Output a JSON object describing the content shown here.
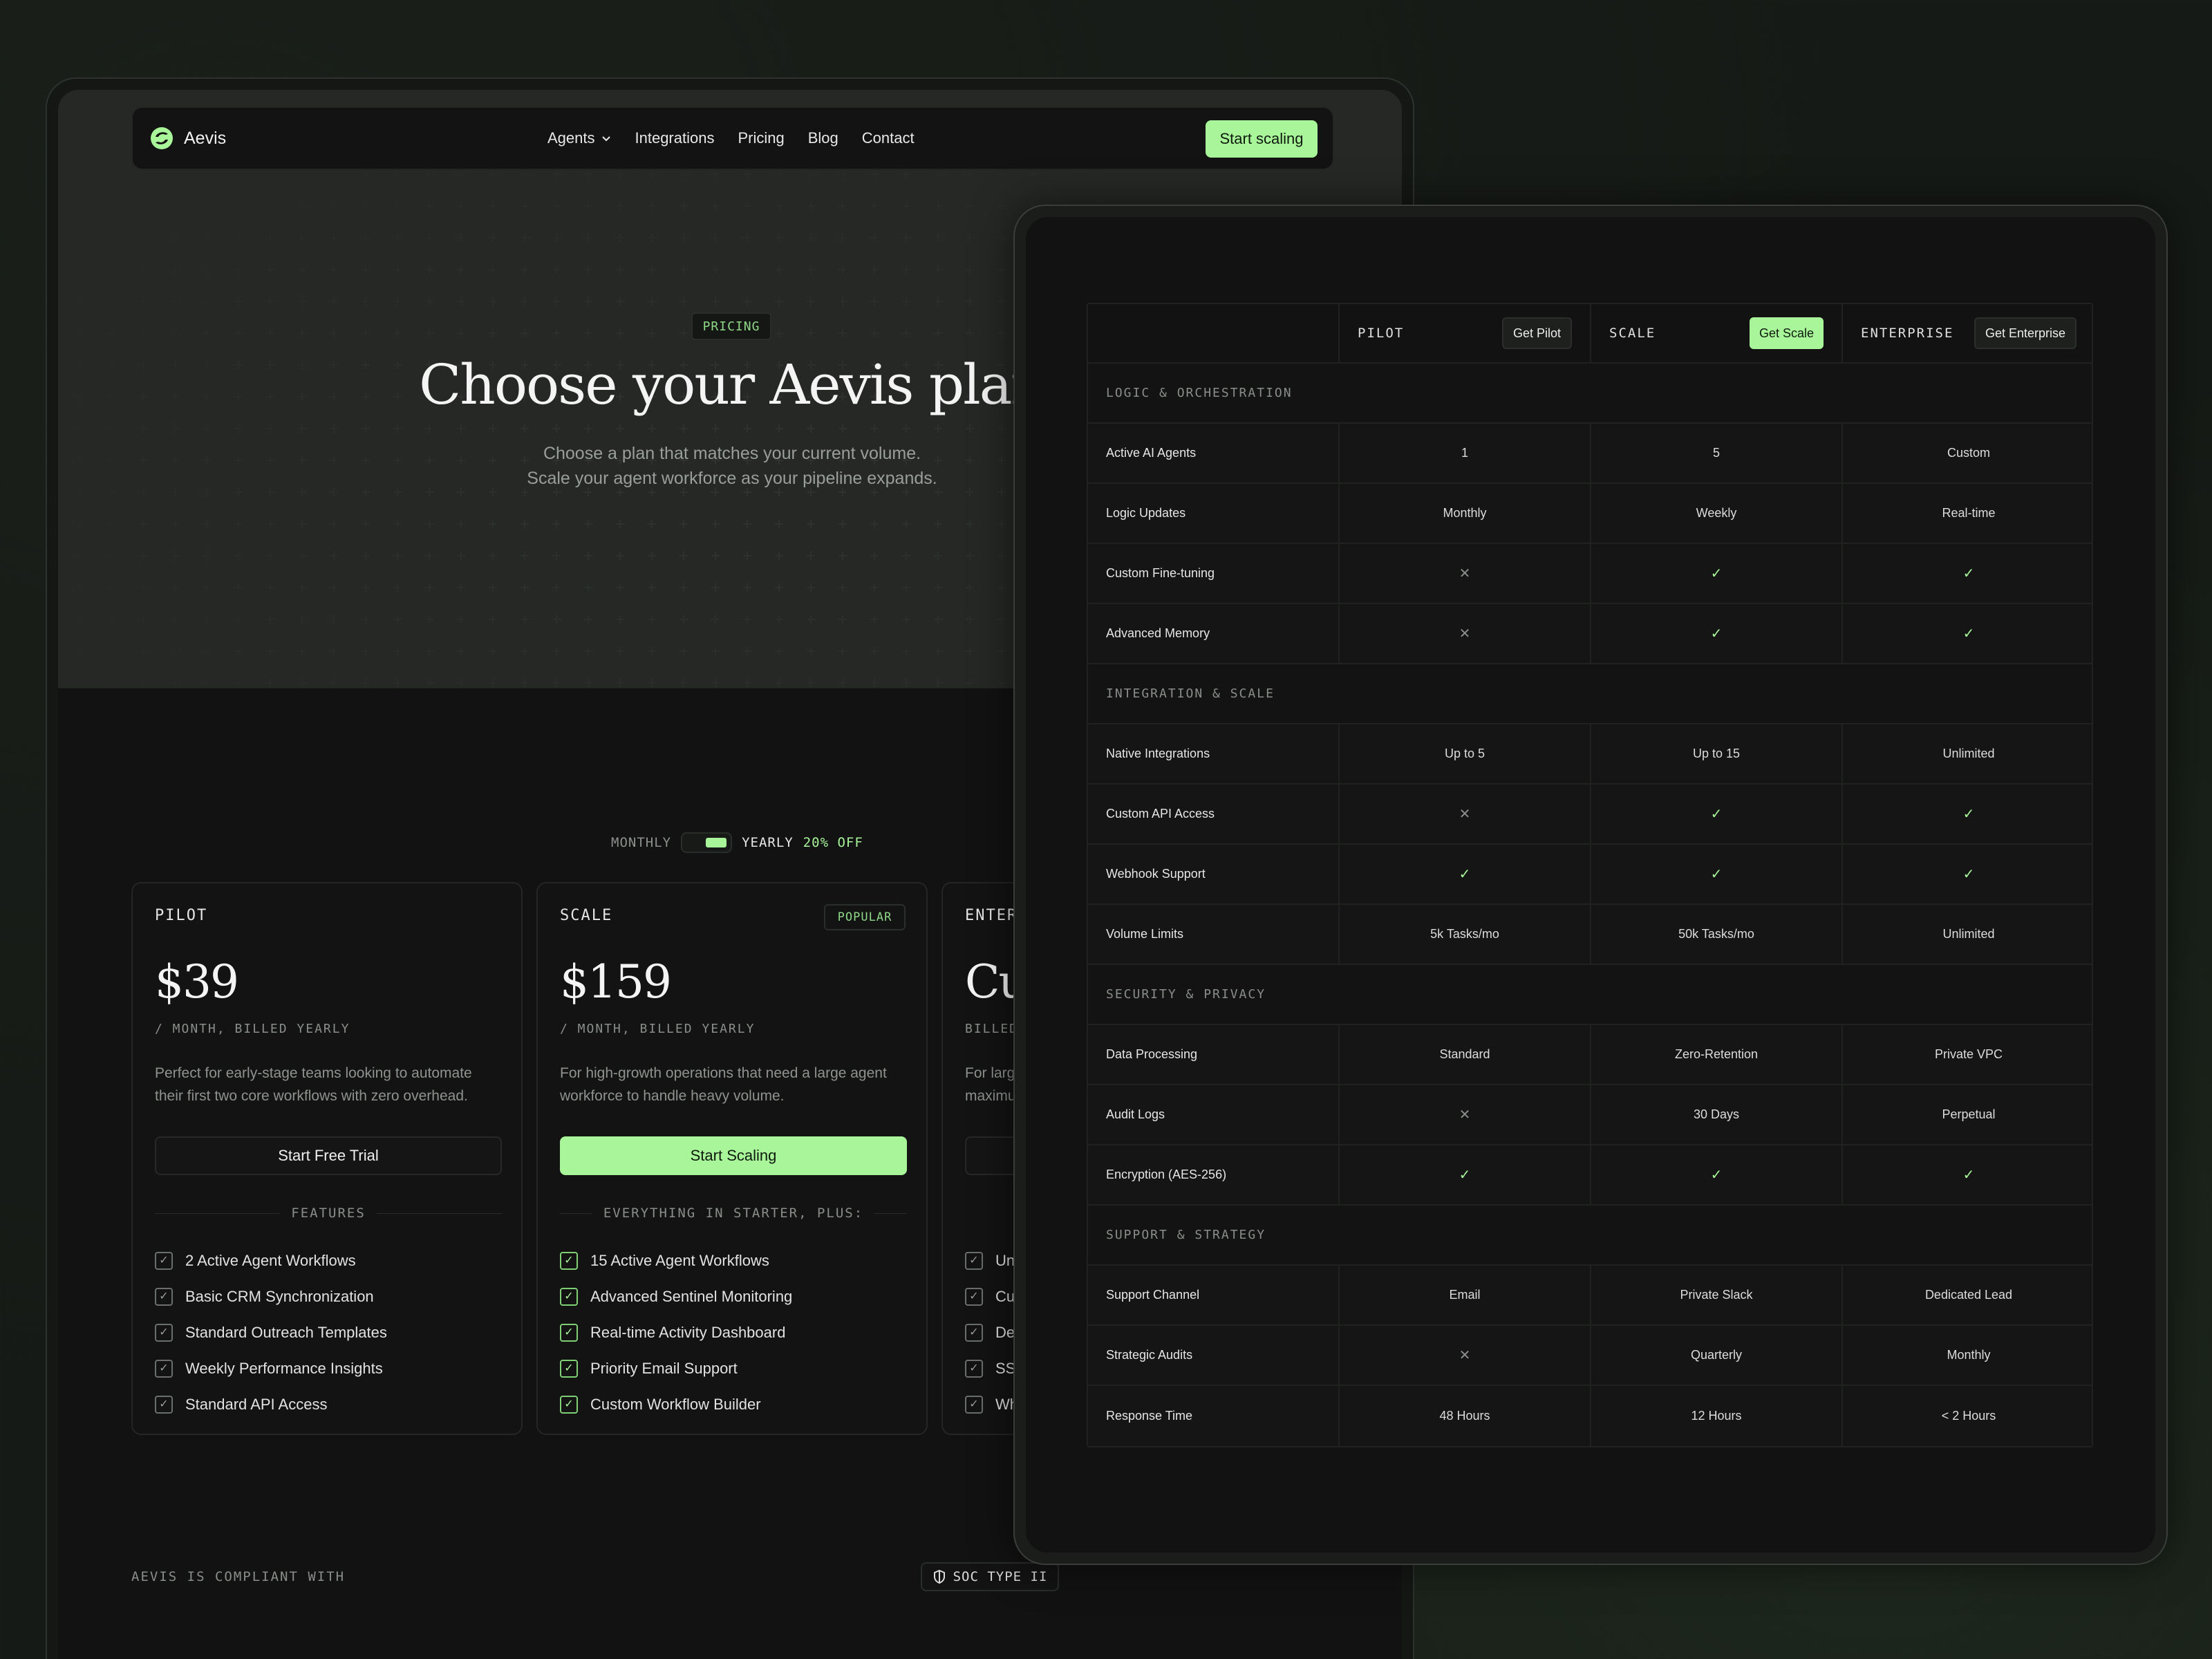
{
  "brand": {
    "name": "Aevis"
  },
  "nav": {
    "links": [
      {
        "label": "Agents",
        "has_dropdown": true
      },
      {
        "label": "Integrations"
      },
      {
        "label": "Pricing"
      },
      {
        "label": "Blog"
      },
      {
        "label": "Contact"
      }
    ],
    "cta": "Start scaling"
  },
  "hero": {
    "badge": "PRICING",
    "title": "Choose your Aevis plan",
    "subtitle_line1": "Choose a plan that matches your current volume.",
    "subtitle_line2": "Scale your agent workforce as your pipeline expands."
  },
  "billing": {
    "monthly": "MONTHLY",
    "yearly": "YEARLY",
    "discount": "20% OFF",
    "selected": "yearly"
  },
  "plans": [
    {
      "tier": "PILOT",
      "price": "$39",
      "period": "/ MONTH, BILLED YEARLY",
      "description": "Perfect for early-stage teams looking to automate their first two core workflows with zero overhead.",
      "cta": "Start Free Trial",
      "features_title": "FEATURES",
      "features": [
        "2 Active Agent Workflows",
        "Basic CRM Synchronization",
        "Standard Outreach Templates",
        "Weekly Performance Insights",
        "Standard API Access"
      ]
    },
    {
      "tier": "SCALE",
      "badge": "POPULAR",
      "price": "$159",
      "period": "/ MONTH, BILLED YEARLY",
      "description": "For high-growth operations that need a large agent workforce to handle heavy volume.",
      "cta": "Start Scaling",
      "features_title": "EVERYTHING IN STARTER, PLUS:",
      "features": [
        "15 Active Agent Workflows",
        "Advanced Sentinel Monitoring",
        "Real-time Activity Dashboard",
        "Priority Email Support",
        "Custom Workflow Builder"
      ]
    },
    {
      "tier": "ENTERI",
      "price": "Cu",
      "period": "BILLED",
      "description_line1": "For larg",
      "description_line2": "maximu",
      "features": [
        "Un",
        "Cu",
        "De",
        "SS",
        "Wh"
      ]
    }
  ],
  "compliance": {
    "label": "AEVIS IS COMPLIANT WITH",
    "badge": "SOC TYPE II"
  },
  "comparison": {
    "columns": [
      {
        "tier": "PILOT",
        "button": "Get Pilot"
      },
      {
        "tier": "SCALE",
        "button": "Get Scale"
      },
      {
        "tier": "ENTERPRISE",
        "button": "Get Enterprise"
      }
    ],
    "sections": [
      {
        "title": "LOGIC & ORCHESTRATION",
        "rows": [
          {
            "feature": "Active AI Agents",
            "values": [
              "1",
              "5",
              "Custom"
            ]
          },
          {
            "feature": "Logic Updates",
            "values": [
              "Monthly",
              "Weekly",
              "Real-time"
            ]
          },
          {
            "feature": "Custom Fine-tuning",
            "values": [
              "✕",
              "✓",
              "✓"
            ]
          },
          {
            "feature": "Advanced Memory",
            "values": [
              "✕",
              "✓",
              "✓"
            ]
          }
        ]
      },
      {
        "title": "INTEGRATION & SCALE",
        "rows": [
          {
            "feature": "Native Integrations",
            "values": [
              "Up to 5",
              "Up to 15",
              "Unlimited"
            ]
          },
          {
            "feature": "Custom API Access",
            "values": [
              "✕",
              "✓",
              "✓"
            ]
          },
          {
            "feature": "Webhook Support",
            "values": [
              "✓",
              "✓",
              "✓"
            ]
          },
          {
            "feature": "Volume Limits",
            "values": [
              "5k Tasks/mo",
              "50k Tasks/mo",
              "Unlimited"
            ]
          }
        ]
      },
      {
        "title": "SECURITY & PRIVACY",
        "rows": [
          {
            "feature": "Data Processing",
            "values": [
              "Standard",
              "Zero-Retention",
              "Private VPC"
            ]
          },
          {
            "feature": "Audit Logs",
            "values": [
              "✕",
              "30 Days",
              "Perpetual"
            ]
          },
          {
            "feature": "Encryption (AES-256)",
            "values": [
              "✓",
              "✓",
              "✓"
            ]
          }
        ]
      },
      {
        "title": "SUPPORT & STRATEGY",
        "rows": [
          {
            "feature": "Support Channel",
            "values": [
              "Email",
              "Private Slack",
              "Dedicated Lead"
            ]
          },
          {
            "feature": "Strategic Audits",
            "values": [
              "✕",
              "Quarterly",
              "Monthly"
            ]
          },
          {
            "feature": "Response Time",
            "values": [
              "48 Hours",
              "12 Hours",
              "< 2 Hours"
            ]
          }
        ]
      }
    ]
  },
  "colors": {
    "accent": "#a8f59a",
    "background": "#111211",
    "border": "#1f221f"
  }
}
